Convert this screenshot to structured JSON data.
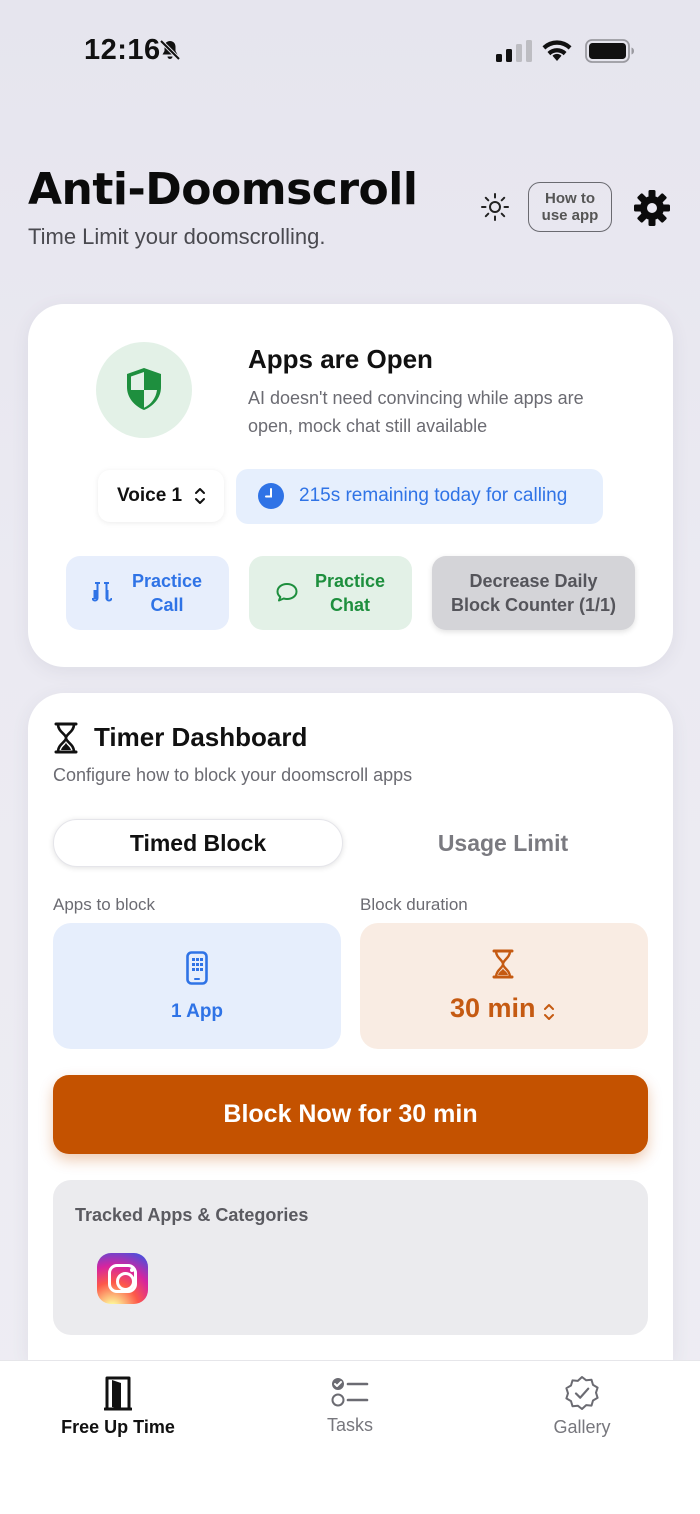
{
  "status_bar": {
    "time": "12:16"
  },
  "header": {
    "title": "Anti-Doomscroll",
    "subtitle": "Time Limit your doomscrolling.",
    "how_to_label_line1": "How to",
    "how_to_label_line2": "use app"
  },
  "status_card": {
    "title": "Apps are Open",
    "description": "AI doesn't need convincing while apps are open, mock chat still available",
    "voice_selected": "Voice 1",
    "remaining_text": "215s remaining today for calling",
    "practice_call_line1": "Practice",
    "practice_call_line2": "Call",
    "practice_chat_line1": "Practice",
    "practice_chat_line2": "Chat",
    "decrease_line1": "Decrease Daily",
    "decrease_line2": "Block Counter (1/1)",
    "colors": {
      "shield": "#1e8f3e",
      "accent_blue": "#2f73e6"
    }
  },
  "timer_dashboard": {
    "title": "Timer Dashboard",
    "subtitle": "Configure how to block your doomscroll apps",
    "tabs": [
      {
        "label": "Timed Block",
        "active": true
      },
      {
        "label": "Usage Limit",
        "active": false
      }
    ],
    "apps_label": "Apps to block",
    "apps_value": "1 App",
    "duration_label": "Block duration",
    "duration_value": "30 min",
    "block_button": "Block Now for 30 min",
    "tracked_title": "Tracked Apps & Categories",
    "tracked_apps": [
      "instagram-icon"
    ],
    "colors": {
      "block_button": "#c45200",
      "duration": "#c55a12"
    }
  },
  "tab_bar": {
    "items": [
      {
        "label": "Free Up Time",
        "icon": "door-icon",
        "active": true
      },
      {
        "label": "Tasks",
        "icon": "checklist-icon",
        "active": false
      },
      {
        "label": "Gallery",
        "icon": "badge-check-icon",
        "active": false
      }
    ]
  }
}
